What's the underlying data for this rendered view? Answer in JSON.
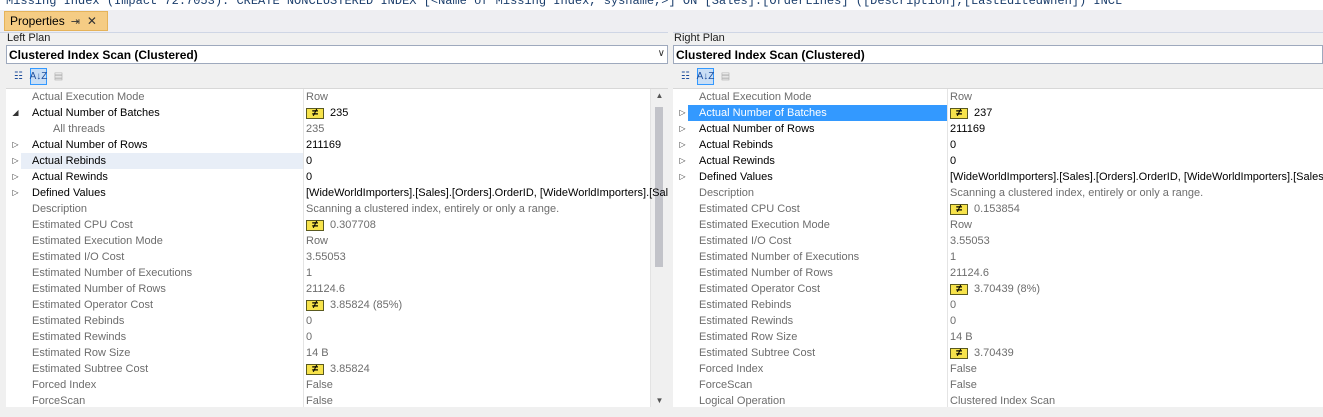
{
  "top_strip": "Missing Index (Impact 72.7053): CREATE NONCLUSTERED INDEX [<Name of Missing Index, sysname,>] ON [Sales].[OrderLines] ([Description],[LastEditedWhen]) INCL",
  "tab": {
    "title": "Properties",
    "pin": "⇥",
    "close": "✕"
  },
  "left": {
    "title": "Left Plan",
    "combo": "Clustered Index Scan (Clustered)",
    "rows": [
      {
        "name": "Actual Execution Mode",
        "value": "Row",
        "gray": true,
        "exp": "",
        "neq": false
      },
      {
        "name": "Actual Number of Batches",
        "value": "235",
        "gray": false,
        "exp": "◢",
        "neq": true
      },
      {
        "name": "All threads",
        "value": "235",
        "gray": true,
        "exp": "",
        "neq": false,
        "child": true
      },
      {
        "name": "Actual Number of Rows",
        "value": "211169",
        "gray": false,
        "exp": "▷",
        "neq": false
      },
      {
        "name": "Actual Rebinds",
        "value": "0",
        "gray": false,
        "exp": "▷",
        "neq": false,
        "hov": true
      },
      {
        "name": "Actual Rewinds",
        "value": "0",
        "gray": false,
        "exp": "▷",
        "neq": false
      },
      {
        "name": "Defined Values",
        "value": "[WideWorldImporters].[Sales].[Orders].OrderID, [WideWorldImporters].[Sales].[Orders].CustomerID",
        "gray": false,
        "exp": "▷",
        "neq": false
      },
      {
        "name": "Description",
        "value": "Scanning a clustered index, entirely or only a range.",
        "gray": true,
        "exp": "",
        "neq": false
      },
      {
        "name": "Estimated CPU Cost",
        "value": "0.307708",
        "gray": true,
        "exp": "",
        "neq": true
      },
      {
        "name": "Estimated Execution Mode",
        "value": "Row",
        "gray": true,
        "exp": "",
        "neq": false
      },
      {
        "name": "Estimated I/O Cost",
        "value": "3.55053",
        "gray": true,
        "exp": "",
        "neq": false
      },
      {
        "name": "Estimated Number of Executions",
        "value": "1",
        "gray": true,
        "exp": "",
        "neq": false
      },
      {
        "name": "Estimated Number of Rows",
        "value": "21124.6",
        "gray": true,
        "exp": "",
        "neq": false
      },
      {
        "name": "Estimated Operator Cost",
        "value": "3.85824 (85%)",
        "gray": true,
        "exp": "",
        "neq": true
      },
      {
        "name": "Estimated Rebinds",
        "value": "0",
        "gray": true,
        "exp": "",
        "neq": false
      },
      {
        "name": "Estimated Rewinds",
        "value": "0",
        "gray": true,
        "exp": "",
        "neq": false
      },
      {
        "name": "Estimated Row Size",
        "value": "14 B",
        "gray": true,
        "exp": "",
        "neq": false
      },
      {
        "name": "Estimated Subtree Cost",
        "value": "3.85824",
        "gray": true,
        "exp": "",
        "neq": true
      },
      {
        "name": "Forced Index",
        "value": "False",
        "gray": true,
        "exp": "",
        "neq": false
      },
      {
        "name": "ForceScan",
        "value": "False",
        "gray": true,
        "exp": "",
        "neq": false
      }
    ]
  },
  "right": {
    "title": "Right Plan",
    "combo": "Clustered Index Scan (Clustered)",
    "rows": [
      {
        "name": "Actual Execution Mode",
        "value": "Row",
        "gray": true,
        "exp": "",
        "neq": false
      },
      {
        "name": "Actual Number of Batches",
        "value": "237",
        "gray": false,
        "exp": "▷",
        "neq": true,
        "sel": true
      },
      {
        "name": "Actual Number of Rows",
        "value": "211169",
        "gray": false,
        "exp": "▷",
        "neq": false
      },
      {
        "name": "Actual Rebinds",
        "value": "0",
        "gray": false,
        "exp": "▷",
        "neq": false
      },
      {
        "name": "Actual Rewinds",
        "value": "0",
        "gray": false,
        "exp": "▷",
        "neq": false
      },
      {
        "name": "Defined Values",
        "value": "[WideWorldImporters].[Sales].[Orders].OrderID, [WideWorldImporters].[Sales].[Orders].CustomerID",
        "gray": false,
        "exp": "▷",
        "neq": false
      },
      {
        "name": "Description",
        "value": "Scanning a clustered index, entirely or only a range.",
        "gray": true,
        "exp": "",
        "neq": false
      },
      {
        "name": "Estimated CPU Cost",
        "value": "0.153854",
        "gray": true,
        "exp": "",
        "neq": true
      },
      {
        "name": "Estimated Execution Mode",
        "value": "Row",
        "gray": true,
        "exp": "",
        "neq": false
      },
      {
        "name": "Estimated I/O Cost",
        "value": "3.55053",
        "gray": true,
        "exp": "",
        "neq": false
      },
      {
        "name": "Estimated Number of Executions",
        "value": "1",
        "gray": true,
        "exp": "",
        "neq": false
      },
      {
        "name": "Estimated Number of Rows",
        "value": "21124.6",
        "gray": true,
        "exp": "",
        "neq": false
      },
      {
        "name": "Estimated Operator Cost",
        "value": "3.70439 (8%)",
        "gray": true,
        "exp": "",
        "neq": true
      },
      {
        "name": "Estimated Rebinds",
        "value": "0",
        "gray": true,
        "exp": "",
        "neq": false
      },
      {
        "name": "Estimated Rewinds",
        "value": "0",
        "gray": true,
        "exp": "",
        "neq": false
      },
      {
        "name": "Estimated Row Size",
        "value": "14 B",
        "gray": true,
        "exp": "",
        "neq": false
      },
      {
        "name": "Estimated Subtree Cost",
        "value": "3.70439",
        "gray": true,
        "exp": "",
        "neq": true
      },
      {
        "name": "Forced Index",
        "value": "False",
        "gray": true,
        "exp": "",
        "neq": false
      },
      {
        "name": "ForceScan",
        "value": "False",
        "gray": true,
        "exp": "",
        "neq": false
      },
      {
        "name": "Logical Operation",
        "value": "Clustered Index Scan",
        "gray": true,
        "exp": "",
        "neq": false
      }
    ]
  },
  "toolbar": {
    "categorized_icon": "☷",
    "alpha_icon": "A↓Z",
    "pages_icon": "▤"
  },
  "neq_symbol": "≠",
  "colors": {
    "tab": "#f5cc84",
    "selection": "#3399ff",
    "neq_badge": "#f7e34b"
  }
}
